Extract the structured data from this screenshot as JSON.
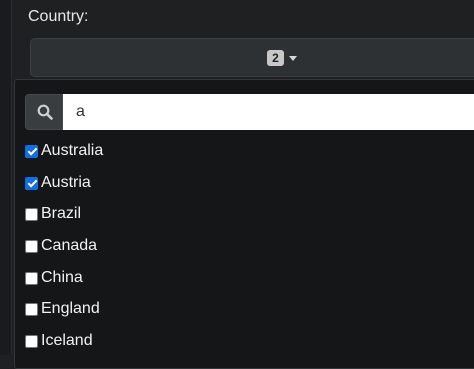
{
  "field": {
    "label": "Country:",
    "selected_count": "2"
  },
  "search": {
    "value": "a",
    "icon": "search-icon"
  },
  "options": [
    {
      "label": "Australia",
      "checked": true
    },
    {
      "label": "Austria",
      "checked": true
    },
    {
      "label": "Brazil",
      "checked": false
    },
    {
      "label": "Canada",
      "checked": false
    },
    {
      "label": "China",
      "checked": false
    },
    {
      "label": "England",
      "checked": false
    },
    {
      "label": "Iceland",
      "checked": false
    }
  ],
  "colors": {
    "background": "#1e2022",
    "dropdown": "#141617",
    "checkbox_checked": "#0f6fe8"
  }
}
